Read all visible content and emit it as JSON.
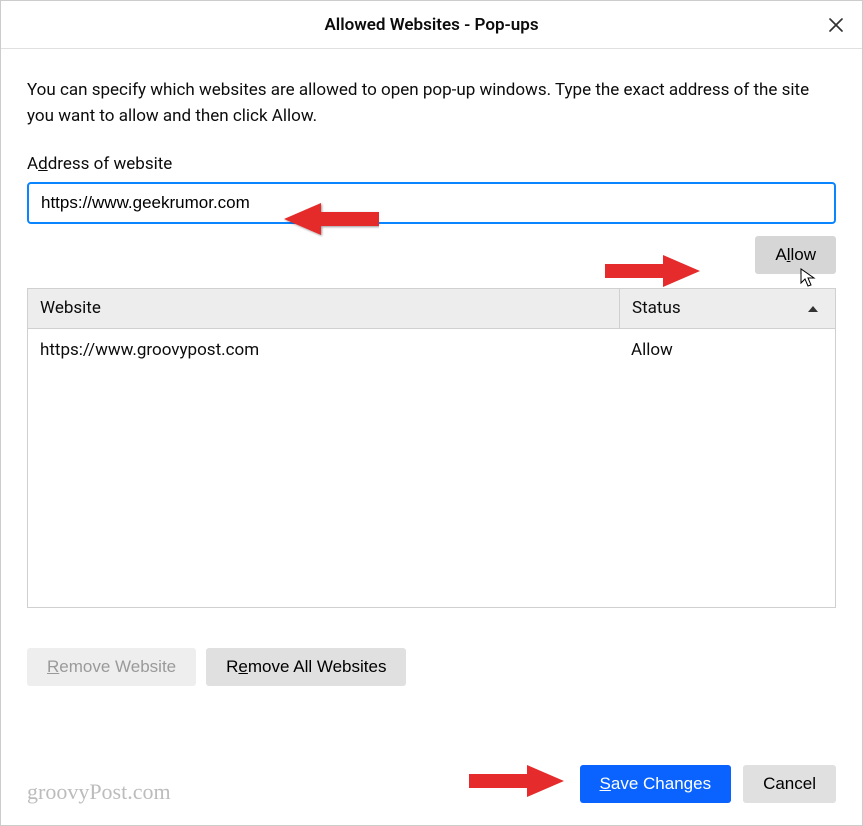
{
  "dialog": {
    "title": "Allowed Websites - Pop-ups",
    "description": "You can specify which websites are allowed to open pop-up windows. Type the exact address of the site you want to allow and then click Allow.",
    "close_label": "Close"
  },
  "address": {
    "label_prefix": "A",
    "label_ul": "d",
    "label_suffix": "dress of website",
    "value": "https://www.geekrumor.com"
  },
  "buttons": {
    "allow_prefix": "A",
    "allow_ul": "l",
    "allow_suffix": "low",
    "remove_website_ul": "R",
    "remove_website_suffix": "emove Website",
    "remove_all_prefix": "R",
    "remove_all_ul": "e",
    "remove_all_suffix": "move All Websites",
    "save_ul": "S",
    "save_suffix": "ave Changes",
    "cancel": "Cancel"
  },
  "table": {
    "header_website": "Website",
    "header_status": "Status",
    "rows": [
      {
        "website": "https://www.groovypost.com",
        "status": "Allow"
      }
    ]
  },
  "watermark": "groovyPost.com"
}
